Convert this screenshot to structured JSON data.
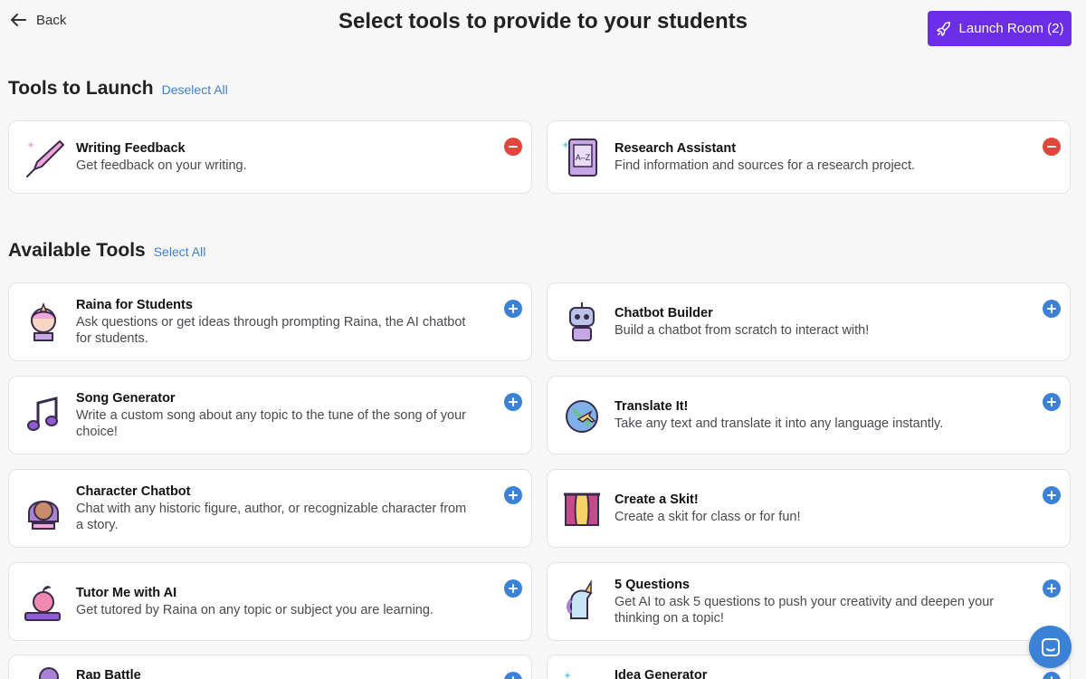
{
  "header": {
    "back_label": "Back",
    "title": "Select tools to provide to your students",
    "launch_label": "Launch Room (2)"
  },
  "colors": {
    "accent": "#6b2ee6",
    "link": "#3b82d6",
    "remove": "#e0473b"
  },
  "launch_section": {
    "title": "Tools to Launch",
    "action": "Deselect All",
    "tools": [
      {
        "name": "Writing Feedback",
        "desc": "Get feedback on your writing.",
        "icon": "pen-icon"
      },
      {
        "name": "Research Assistant",
        "desc": "Find information and sources for a research project.",
        "icon": "book-az-icon"
      }
    ]
  },
  "available_section": {
    "title": "Available Tools",
    "action": "Select All",
    "tools": [
      {
        "name": "Raina for Students",
        "desc": "Ask questions or get ideas through prompting Raina, the AI chatbot for students.",
        "icon": "unicorn-girl-icon"
      },
      {
        "name": "Chatbot Builder",
        "desc": "Build a chatbot from scratch to interact with!",
        "icon": "robot-icon"
      },
      {
        "name": "Song Generator",
        "desc": "Write a custom song about any topic to the tune of the song of your choice!",
        "icon": "music-note-icon"
      },
      {
        "name": "Translate It!",
        "desc": "Take any text and translate it into any language instantly.",
        "icon": "globe-plane-icon"
      },
      {
        "name": "Character Chatbot",
        "desc": "Chat with any historic figure, author, or recognizable character from a story.",
        "icon": "character-girl-icon"
      },
      {
        "name": "Create a Skit!",
        "desc": "Create a skit for class or for fun!",
        "icon": "theater-stage-icon"
      },
      {
        "name": "Tutor Me with AI",
        "desc": "Get tutored by Raina on any topic or subject you are learning.",
        "icon": "apple-books-icon"
      },
      {
        "name": "5 Questions",
        "desc": "Get AI to ask 5 questions to push your creativity and deepen your thinking on a topic!",
        "icon": "unicorn-icon"
      },
      {
        "name": "Rap Battle",
        "desc": "",
        "icon": "microphone-icon"
      },
      {
        "name": "Idea Generator",
        "desc": "",
        "icon": "lightbulb-icon"
      }
    ]
  }
}
